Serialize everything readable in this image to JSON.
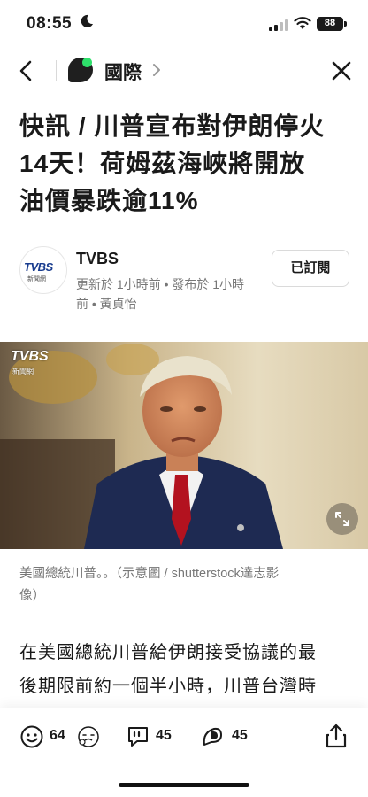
{
  "status_bar": {
    "time": "08:55",
    "battery": "88"
  },
  "nav": {
    "channel": "國際"
  },
  "article": {
    "headline_lines": [
      "快訊 / 川普宣布對伊朗停火",
      "14天！荷姆茲海峽將開放",
      "油價暴跌逾11%"
    ],
    "source_name": "TVBS",
    "source_logo_text": "TVBS",
    "source_logo_sub": "新聞網",
    "meta_lines": [
      "更新於 1小時前 • 發布於 1小時",
      "前 • 黃貞怡"
    ],
    "subscribe_label": "已訂閱",
    "image_watermark": "TVBS",
    "image_watermark_sub": "新聞網",
    "caption_lines": [
      "美國總統川普。。（示意圖 / shutterstock達志影",
      "像）"
    ],
    "body_lines": [
      "在美國總統川普給伊朗接受協議的最",
      "後期限前約一個半小時，川普台灣時"
    ]
  },
  "bottom_bar": {
    "emoji_count": "64",
    "comment_count": "45",
    "repost_count": "45"
  },
  "colors": {
    "accent_green": "#2ee06b",
    "text": "#1a1a1a",
    "muted": "#777777"
  }
}
